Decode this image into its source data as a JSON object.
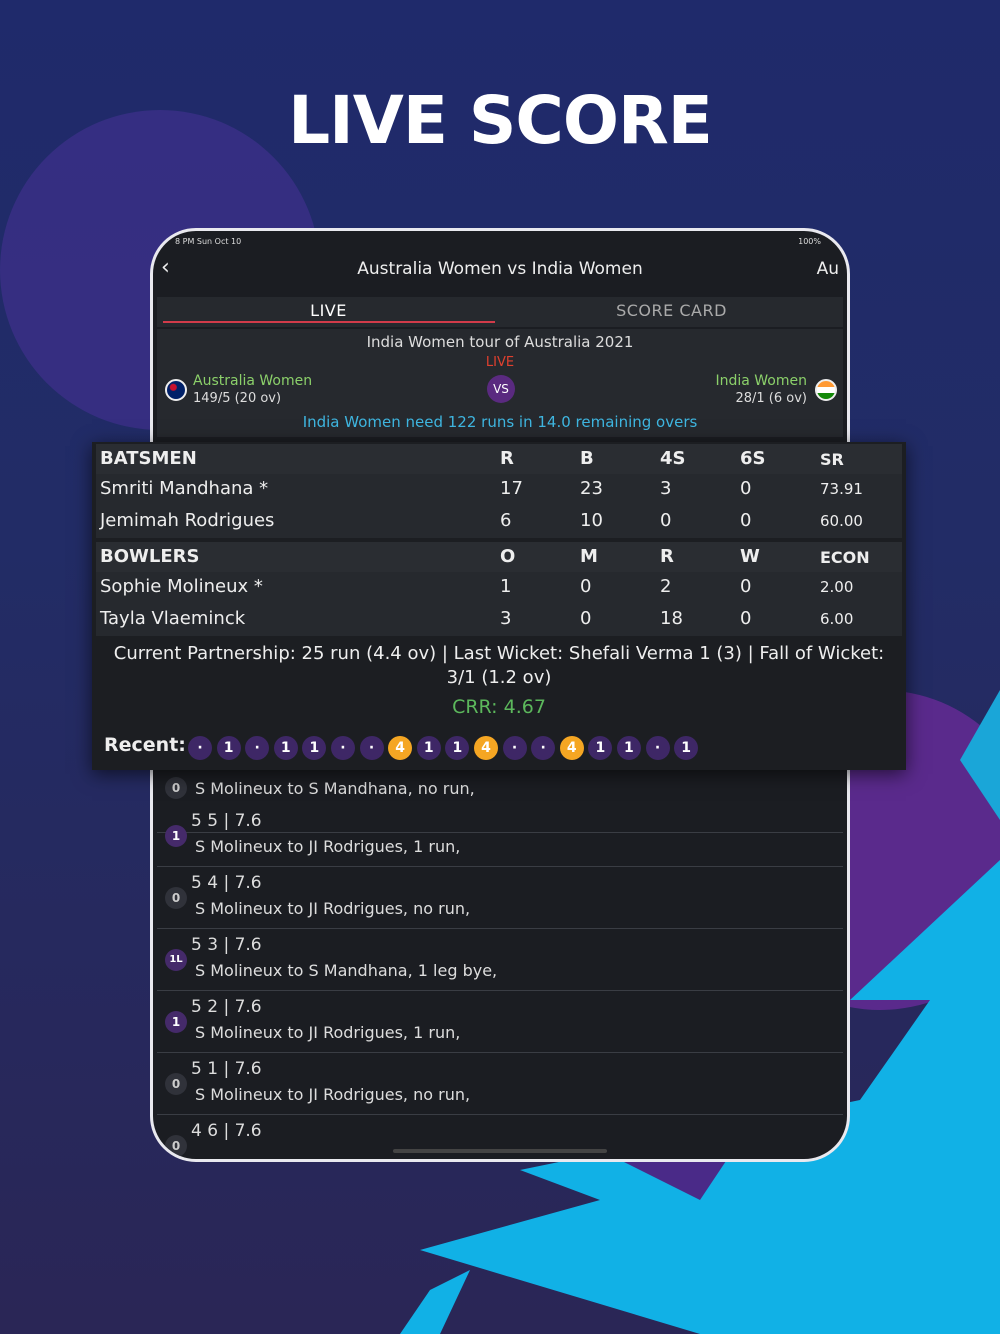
{
  "headline": "LIVE SCORE",
  "status_bar": {
    "time": "8 PM  Sun Oct 10",
    "battery": "100%"
  },
  "nav": {
    "back_icon": "chevron-left-icon",
    "title": "Australia Women vs India Women",
    "right": "Au"
  },
  "tabs": [
    {
      "label": "LIVE",
      "active": true
    },
    {
      "label": "SCORE CARD",
      "active": false
    }
  ],
  "match": {
    "series": "India Women tour of Australia 2021",
    "status": "LIVE",
    "vs": "VS",
    "team_a": {
      "name": "Australia Women",
      "score": "149/5 (20 ov)"
    },
    "team_b": {
      "name": "India Women",
      "score": "28/1 (6 ov)"
    },
    "target_text": "India Women need 122 runs in 14.0 remaining overs"
  },
  "batsmen": {
    "headers": [
      "BATSMEN",
      "R",
      "B",
      "4S",
      "6S",
      "SR"
    ],
    "rows": [
      [
        "Smriti Mandhana *",
        "17",
        "23",
        "3",
        "0",
        "73.91"
      ],
      [
        "Jemimah Rodrigues",
        "6",
        "10",
        "0",
        "0",
        "60.00"
      ]
    ]
  },
  "bowlers": {
    "headers": [
      "BOWLERS",
      "O",
      "M",
      "R",
      "W",
      "ECON"
    ],
    "rows": [
      [
        "Sophie Molineux *",
        "1",
        "0",
        "2",
        "0",
        "2.00"
      ],
      [
        "Tayla Vlaeminck",
        "3",
        "0",
        "18",
        "0",
        "6.00"
      ]
    ]
  },
  "partnership": "Current Partnership: 25 run (4.4 ov) | Last Wicket: Shefali Verma 1 (3) | Fall of Wicket: 3/1 (1.2 ov)",
  "crr": "CRR: 4.67",
  "recent": {
    "label": "Recent:",
    "balls": [
      "·",
      "1",
      "·",
      "1",
      "1",
      "·",
      "·",
      "4",
      "1",
      "1",
      "4",
      "·",
      "·",
      "4",
      "1",
      "1",
      "·",
      "1"
    ]
  },
  "commentary": [
    {
      "ball": "0",
      "over": "",
      "desc": "S Molineux to S Mandhana, no run,"
    },
    {
      "ball": "1",
      "over": "5 5 | 7.6",
      "desc": "S Molineux to JI Rodrigues, 1 run,"
    },
    {
      "ball": "0",
      "over": "5 4 | 7.6",
      "desc": "S Molineux to JI Rodrigues, no run,"
    },
    {
      "ball": "1L",
      "over": "5 3 | 7.6",
      "desc": "S Molineux to S Mandhana, 1 leg bye,"
    },
    {
      "ball": "1",
      "over": "5 2 | 7.6",
      "desc": "S Molineux to JI Rodrigues, 1 run,"
    },
    {
      "ball": "0",
      "over": "5 1 | 7.6",
      "desc": "S Molineux to JI Rodrigues, no run,"
    },
    {
      "ball": "0",
      "over": "4 6 | 7.6",
      "desc": ""
    }
  ],
  "colors": {
    "accent_live": "#d23b4a",
    "team_green": "#8bd06a",
    "info_blue": "#3fb6e0",
    "crr_green": "#5cb85c",
    "four": "#f5a623",
    "ball_purple": "#3e2766"
  }
}
